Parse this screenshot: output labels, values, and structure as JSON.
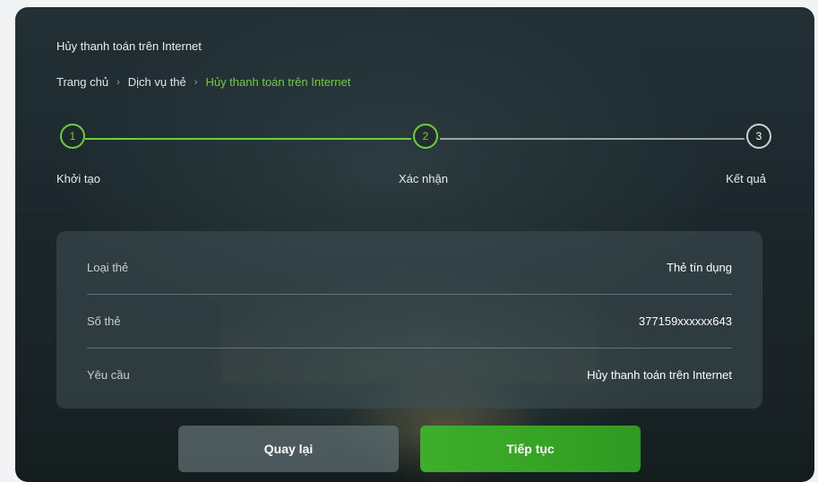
{
  "page": {
    "title": "Hủy thanh toán trên Internet"
  },
  "breadcrumb": {
    "items": [
      "Trang chủ",
      "Dịch vụ thẻ",
      "Hủy thanh toán trên Internet"
    ],
    "separator": "›"
  },
  "stepper": {
    "steps": [
      {
        "number": "1",
        "label": "Khởi tạo",
        "state": "done"
      },
      {
        "number": "2",
        "label": "Xác nhận",
        "state": "current"
      },
      {
        "number": "3",
        "label": "Kết quả",
        "state": "todo"
      }
    ]
  },
  "details": {
    "rows": [
      {
        "label": "Loại thẻ",
        "value": "Thẻ tín dụng"
      },
      {
        "label": "Số thẻ",
        "value": "377159xxxxxx643"
      },
      {
        "label": "Yêu cầu",
        "value": "Hủy thanh toán trên Internet"
      }
    ]
  },
  "actions": {
    "back_label": "Quay lại",
    "next_label": "Tiếp tục"
  },
  "colors": {
    "accent": "#6dcf3c",
    "primary_button": "#3fae2a",
    "background": "#1b272c"
  }
}
